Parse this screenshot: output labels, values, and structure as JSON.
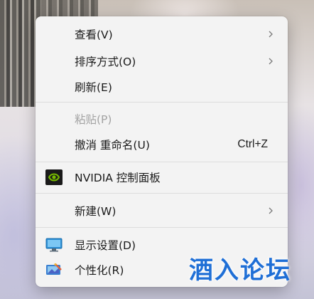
{
  "context_menu": {
    "items": [
      {
        "label": "查看(V)"
      },
      {
        "label": "排序方式(O)"
      },
      {
        "label": "刷新(E)"
      },
      {
        "label": "粘贴(P)"
      },
      {
        "label": "撤消 重命名(U)",
        "shortcut": "Ctrl+Z"
      },
      {
        "label": "NVIDIA 控制面板"
      },
      {
        "label": "新建(W)"
      },
      {
        "label": "显示设置(D)"
      },
      {
        "label": "个性化(R)"
      }
    ]
  },
  "icons": {
    "submenu": "chevron-right-icon",
    "nvidia": "nvidia-logo-icon",
    "display": "monitor-icon",
    "personalize": "personalize-icon"
  },
  "colors": {
    "menu_background": "#f3f3f3",
    "disabled_text": "#a3a3a3",
    "nvidia_green": "#76b900",
    "watermark_blue": "#1f6fd6"
  },
  "watermark": {
    "text": "酒入论坛"
  }
}
